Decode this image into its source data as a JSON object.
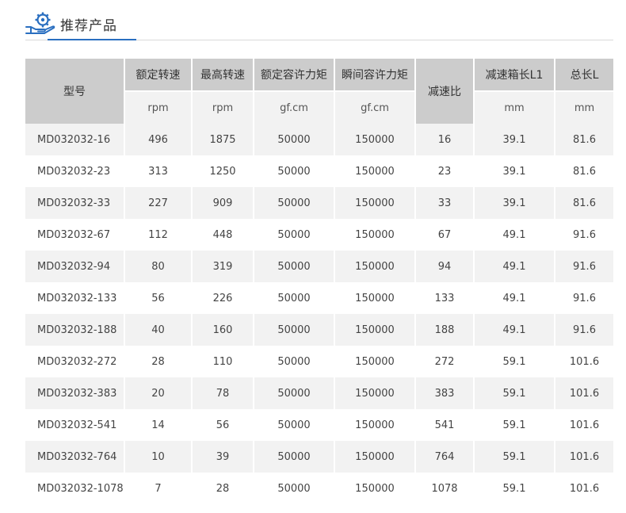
{
  "header": {
    "title": "推荐产品",
    "icon": "hand-gear-icon",
    "accent_color": "#2a6fc0"
  },
  "table": {
    "columns": {
      "model": "型号",
      "rated_speed": "额定转速",
      "max_speed": "最高转速",
      "rated_torque": "额定容许力矩",
      "instant_torque": "瞬间容许力矩",
      "ratio": "减速比",
      "gearbox_length": "减速箱长L1",
      "total_length": "总长L"
    },
    "units": {
      "rated_speed": "rpm",
      "max_speed": "rpm",
      "rated_torque": "gf.cm",
      "instant_torque": "gf.cm",
      "gearbox_length": "mm",
      "total_length": "mm"
    },
    "rows": [
      [
        "MD032032-16",
        "496",
        "1875",
        "50000",
        "150000",
        "16",
        "39.1",
        "81.6"
      ],
      [
        "MD032032-23",
        "313",
        "1250",
        "50000",
        "150000",
        "23",
        "39.1",
        "81.6"
      ],
      [
        "MD032032-33",
        "227",
        "909",
        "50000",
        "150000",
        "33",
        "39.1",
        "81.6"
      ],
      [
        "MD032032-67",
        "112",
        "448",
        "50000",
        "150000",
        "67",
        "49.1",
        "91.6"
      ],
      [
        "MD032032-94",
        "80",
        "319",
        "50000",
        "150000",
        "94",
        "49.1",
        "91.6"
      ],
      [
        "MD032032-133",
        "56",
        "226",
        "50000",
        "150000",
        "133",
        "49.1",
        "91.6"
      ],
      [
        "MD032032-188",
        "40",
        "160",
        "50000",
        "150000",
        "188",
        "49.1",
        "91.6"
      ],
      [
        "MD032032-272",
        "28",
        "110",
        "50000",
        "150000",
        "272",
        "59.1",
        "101.6"
      ],
      [
        "MD032032-383",
        "20",
        "78",
        "50000",
        "150000",
        "383",
        "59.1",
        "101.6"
      ],
      [
        "MD032032-541",
        "14",
        "56",
        "50000",
        "150000",
        "541",
        "59.1",
        "101.6"
      ],
      [
        "MD032032-764",
        "10",
        "39",
        "50000",
        "150000",
        "764",
        "59.1",
        "101.6"
      ],
      [
        "MD032032-1078",
        "7",
        "28",
        "50000",
        "150000",
        "1078",
        "59.1",
        "101.6"
      ]
    ]
  }
}
